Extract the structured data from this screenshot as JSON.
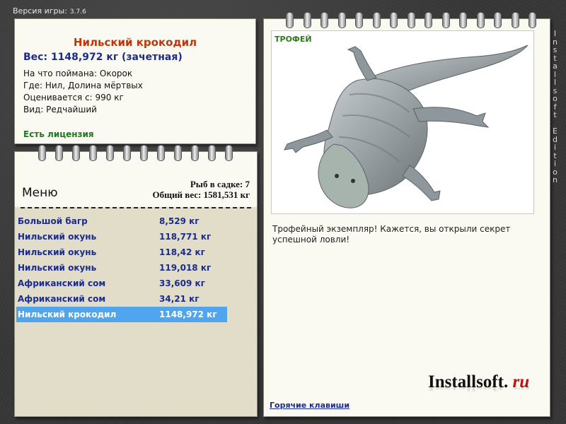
{
  "app": {
    "version_label": "Версия игры:",
    "version_number": "3.7.6",
    "side_text": "Installsoft Edition"
  },
  "trophy_info": {
    "title": "Нильский крокодил",
    "weight": "Вес: 1148,972 кг (зачетная)",
    "caught_on": "На что поймана: Окорок",
    "location": "Где: Нил, Долина мёртвых",
    "rated_from": "Оценивается с: 990 кг",
    "kind": "Вид: Редчайший",
    "license": "Есть лицензия"
  },
  "menu": {
    "header": "Меню",
    "fish_count": "Рыб в садке: 7",
    "total_weight": "Общий вес: 1581,531 кг",
    "items": [
      {
        "name": "Большой багр",
        "weight": "8,529 кг"
      },
      {
        "name": "Нильский окунь",
        "weight": "118,771 кг"
      },
      {
        "name": "Нильский окунь",
        "weight": "118,42 кг"
      },
      {
        "name": "Нильский окунь",
        "weight": "119,018 кг"
      },
      {
        "name": "Африканский сом",
        "weight": "33,609 кг"
      },
      {
        "name": "Африканский сом",
        "weight": "34,21 кг"
      },
      {
        "name": "Нильский крокодил",
        "weight": "1148,972 кг"
      }
    ],
    "selected_index": 6
  },
  "trophy_panel": {
    "tag": "ТРОФЕЙ",
    "image_icon": "crocodile-image",
    "description": "Трофейный экземпляр! Кажется, вы открыли секрет успешной ловли!",
    "hotkeys_link": "Горячие клавиши",
    "logo_main": "Installsoft.",
    "logo_ru": "ru"
  },
  "colors": {
    "title": "#c0360a",
    "accent_blue": "#1b2c8a",
    "license_green": "#1e7a1e",
    "selection": "#4fa6ef"
  }
}
